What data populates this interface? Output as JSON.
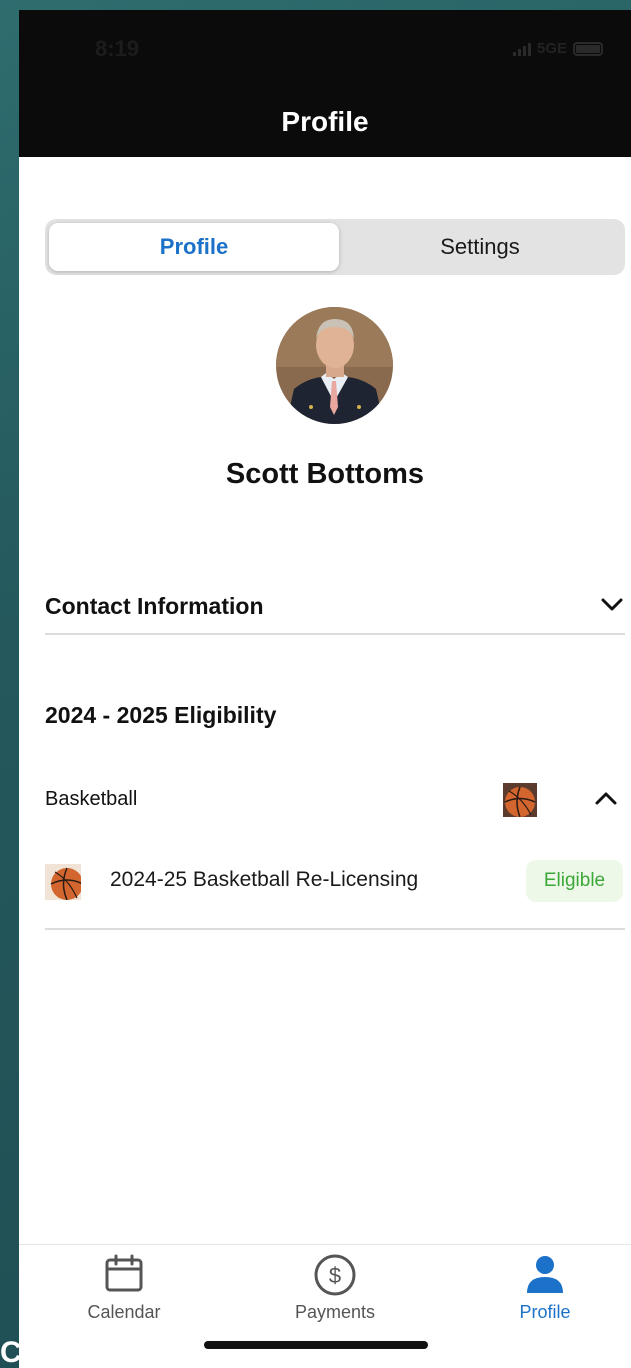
{
  "status_bar": {
    "time": "8:19",
    "network": "5GE"
  },
  "header": {
    "title": "Profile"
  },
  "segments": {
    "active_label": "Profile",
    "inactive_label": "Settings"
  },
  "user": {
    "name": "Scott Bottoms"
  },
  "contact": {
    "label": "Contact Information",
    "icon": "chevron-down-icon"
  },
  "eligibility": {
    "title": "2024 - 2025 Eligibility",
    "sport": {
      "label": "Basketball",
      "icon": "chevron-up-icon"
    },
    "items": [
      {
        "label": "2024-25 Basketball Re-Licensing",
        "status": "Eligible"
      }
    ]
  },
  "tabbar": {
    "items": [
      {
        "label": "Calendar",
        "icon": "calendar-icon"
      },
      {
        "label": "Payments",
        "icon": "dollar-icon"
      },
      {
        "label": "Profile",
        "icon": "person-icon",
        "active": true
      }
    ]
  },
  "colors": {
    "accent": "#1c72c8",
    "eligible_text": "#3ca83a",
    "eligible_bg": "#eef8e8",
    "header_bg": "#0b0b0b"
  }
}
